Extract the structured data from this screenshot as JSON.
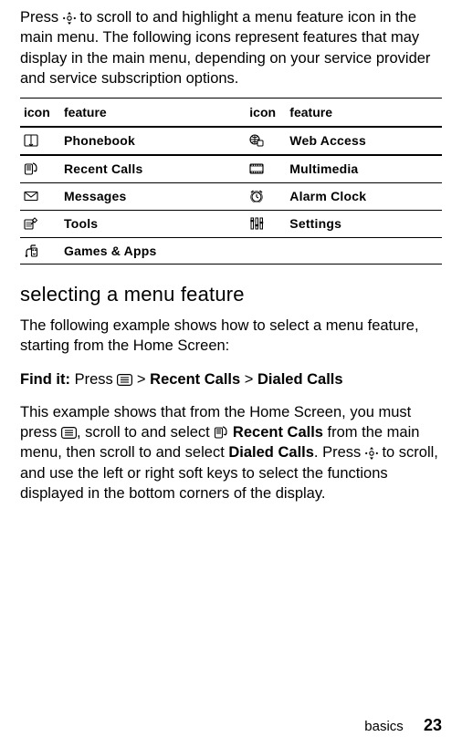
{
  "intro": {
    "part1": "Press ",
    "part2": " to scroll to and highlight a menu feature icon in the main menu. The following icons represent features that may display in the main menu, depending on your service provider and service subscription options."
  },
  "table": {
    "headers": {
      "icon1": "icon",
      "feat1": "feature",
      "icon2": "icon",
      "feat2": "feature"
    },
    "rows": [
      {
        "f1": "Phonebook",
        "f2": "Web Access"
      },
      {
        "f1": "Recent Calls",
        "f2": "Multimedia"
      },
      {
        "f1": "Messages",
        "f2": "Alarm Clock"
      },
      {
        "f1": "Tools",
        "f2": "Settings"
      },
      {
        "f1": "Games & Apps",
        "f2": ""
      }
    ]
  },
  "heading": "selecting a menu feature",
  "para1": "The following example shows how to select a menu feature, starting from the Home Screen:",
  "findit": {
    "label": "Find it:",
    "p1": "Press ",
    "gt1": " > ",
    "b1": "Recent Calls",
    "gt2": " > ",
    "b2": "Dialed Calls"
  },
  "para2": {
    "p1": "This example shows that from the Home Screen, you must press ",
    "p2": ", scroll to and select ",
    "b1": " Recent Calls",
    "p3": " from the main menu, then scroll to and select ",
    "b2": "Dialed Calls",
    "p4": ". Press ",
    "p5": " to scroll, and use the left or right soft keys to select the functions displayed in the bottom corners of the display."
  },
  "footer": {
    "section": "basics",
    "page": "23"
  }
}
